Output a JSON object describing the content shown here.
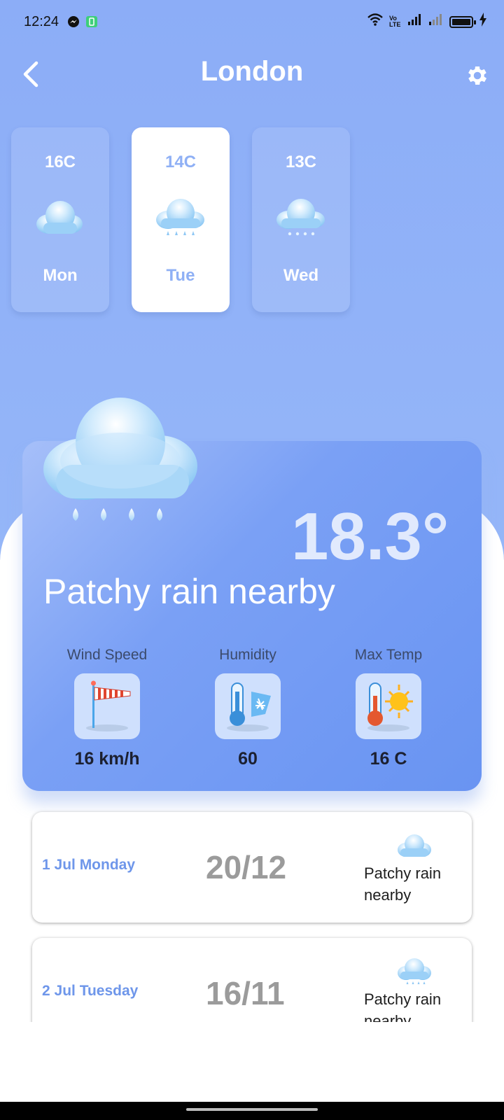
{
  "status_bar": {
    "time": "12:24",
    "volte_label": "Vo LTE"
  },
  "header": {
    "title": "London",
    "back_icon": "chevron-left-icon",
    "settings_icon": "gear-icon"
  },
  "days": [
    {
      "temp": "16C",
      "day": "Mon",
      "icon": "cloud-icon",
      "selected": false
    },
    {
      "temp": "14C",
      "day": "Tue",
      "icon": "cloud-rain-icon",
      "selected": true
    },
    {
      "temp": "13C",
      "day": "Wed",
      "icon": "cloud-drizzle-icon",
      "selected": false
    }
  ],
  "current": {
    "temperature": "18.3°",
    "condition": "Patchy rain nearby",
    "icon": "cloud-rain-icon"
  },
  "stats": [
    {
      "label": "Wind Speed",
      "value": "16 km/h",
      "icon": "windsock-icon"
    },
    {
      "label": "Humidity",
      "value": "60",
      "icon": "thermometer-snow-icon"
    },
    {
      "label": "Max Temp",
      "value": "16 C",
      "icon": "thermometer-sun-icon"
    }
  ],
  "forecast": [
    {
      "date": "1 Jul Monday",
      "temps": "20/12",
      "condition": "Patchy rain nearby",
      "icon": "cloud-icon"
    },
    {
      "date": "2 Jul Tuesday",
      "temps": "16/11",
      "condition": "Patchy rain nearby",
      "icon": "cloud-drizzle-icon"
    }
  ],
  "colors": {
    "accent": "#8cadf7",
    "card_blue": "#6994f2",
    "date_blue": "#6e96ea"
  }
}
